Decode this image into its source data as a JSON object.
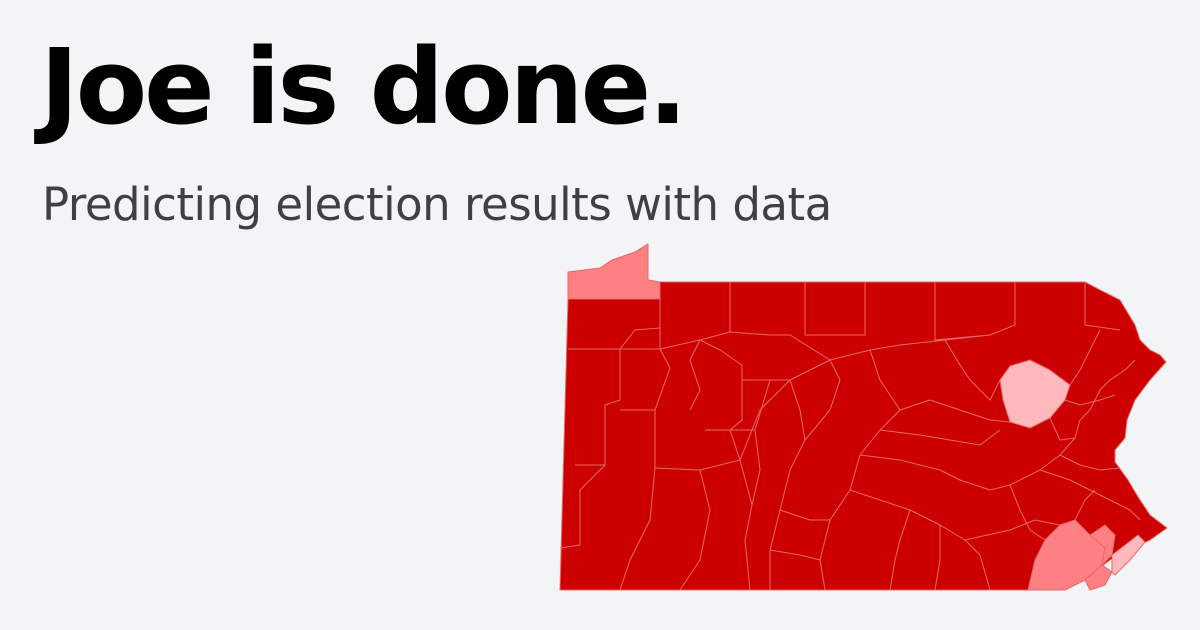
{
  "headline": "Joe is done.",
  "subtitle": "Predicting election results with data",
  "map": {
    "region": "Pennsylvania",
    "colors": {
      "safe": "#cc0000",
      "lean": "#ff8083",
      "tilt": "#ffb8bb",
      "border": "#e56969"
    },
    "highlighted_counties": [
      {
        "name": "Erie",
        "level": "lean"
      },
      {
        "name": "Lackawanna",
        "level": "tilt"
      },
      {
        "name": "Chester",
        "level": "lean"
      },
      {
        "name": "Montgomery",
        "level": "lean"
      },
      {
        "name": "Delaware",
        "level": "lean"
      },
      {
        "name": "Philadelphia",
        "level": "tilt"
      }
    ]
  }
}
